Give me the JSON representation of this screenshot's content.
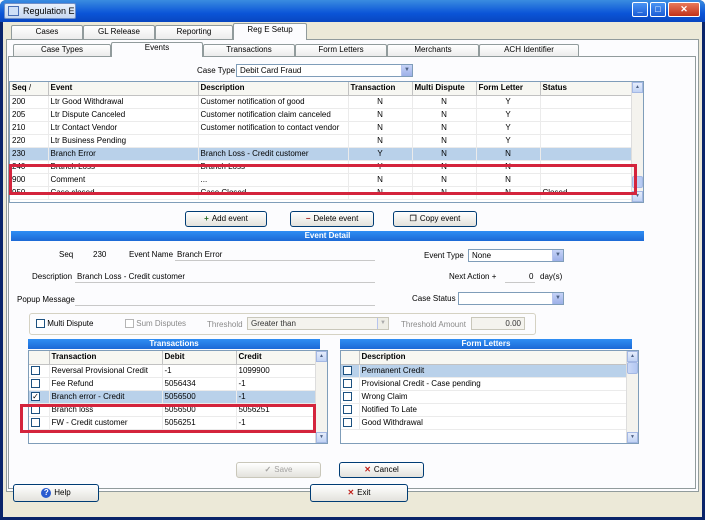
{
  "titlebar": {
    "app_tab": "Regulation E",
    "minimize": "_",
    "maximize": "□",
    "close": "✕"
  },
  "main_tabs": [
    "Cases",
    "GL Release",
    "Reporting",
    "Reg E Setup"
  ],
  "sub_tabs": [
    "Case Types",
    "Events",
    "Transactions",
    "Form Letters",
    "Merchants",
    "ACH Identifier"
  ],
  "case_type": {
    "label": "Case Type",
    "value": "Debit Card Fraud"
  },
  "events_grid": {
    "columns": [
      "Seq",
      "Event",
      "Description",
      "Transaction",
      "Multi Dispute",
      "Form Letter",
      "Status"
    ],
    "sort_indicator": "/",
    "rows": [
      {
        "seq": "200",
        "event": "Ltr Good Withdrawal",
        "description": "Customer notification of good",
        "transaction": "N",
        "multi": "N",
        "form": "Y",
        "status": ""
      },
      {
        "seq": "205",
        "event": "Ltr Dispute Canceled",
        "description": "Customer notification claim canceled",
        "transaction": "N",
        "multi": "N",
        "form": "Y",
        "status": ""
      },
      {
        "seq": "210",
        "event": "Ltr Contact Vendor",
        "description": "Customer notification to contact vendor",
        "transaction": "N",
        "multi": "N",
        "form": "Y",
        "status": ""
      },
      {
        "seq": "220",
        "event": "Ltr Business Pending",
        "description": "",
        "transaction": "N",
        "multi": "N",
        "form": "Y",
        "status": ""
      },
      {
        "seq": "230",
        "event": "Branch Error",
        "description": "Branch Loss - Credit customer",
        "transaction": "Y",
        "multi": "N",
        "form": "N",
        "status": ""
      },
      {
        "seq": "240",
        "event": "Branch Loss",
        "description": "Branch Loss",
        "transaction": "Y",
        "multi": "N",
        "form": "N",
        "status": ""
      },
      {
        "seq": "900",
        "event": "Comment",
        "description": "...",
        "transaction": "N",
        "multi": "N",
        "form": "N",
        "status": ""
      },
      {
        "seq": "950",
        "event": "Case closed",
        "description": "Case Closed",
        "transaction": "N",
        "multi": "N",
        "form": "N",
        "status": "Closed"
      }
    ]
  },
  "event_buttons": {
    "add": "Add event",
    "delete": "Delete event",
    "copy": "Copy event"
  },
  "event_detail": {
    "header": "Event Detail",
    "seq_label": "Seq",
    "seq_value": "230",
    "event_name_label": "Event Name",
    "event_name_value": "Branch Error",
    "description_label": "Description",
    "description_value": "Branch Loss - Credit customer",
    "popup_label": "Popup Message",
    "event_type_label": "Event Type",
    "event_type_value": "None",
    "next_action_label": "Next Action +",
    "next_action_value": "0",
    "next_action_unit": "day(s)",
    "case_status_label": "Case Status",
    "case_status_value": "",
    "multi_dispute_label": "Multi Dispute",
    "sum_disputes_label": "Sum Disputes",
    "threshold_label": "Threshold",
    "threshold_value": "Greater than",
    "threshold_amount_label": "Threshold Amount",
    "threshold_amount_value": "0.00"
  },
  "transactions": {
    "header": "Transactions",
    "columns": [
      "Transaction",
      "Debit",
      "Credit"
    ],
    "rows": [
      {
        "checked": false,
        "name": "Reversal Provisional Credit",
        "debit": "-1",
        "credit": "1099900"
      },
      {
        "checked": false,
        "name": "Fee Refund",
        "debit": "5056434",
        "credit": "-1"
      },
      {
        "checked": true,
        "name": "Branch error - Credit",
        "debit": "5056500",
        "credit": "-1"
      },
      {
        "checked": false,
        "name": "Branch loss",
        "debit": "5056500",
        "credit": "5056251"
      },
      {
        "checked": false,
        "name": "FW - Credit customer",
        "debit": "5056251",
        "credit": "-1"
      }
    ]
  },
  "form_letters": {
    "header": "Form Letters",
    "columns": [
      "Description"
    ],
    "rows": [
      "Permanent Credit",
      "Provisional Credit - Case pending",
      "Wrong Claim",
      "Notified To Late",
      "Good Withdrawal"
    ]
  },
  "action_buttons": {
    "save": "Save",
    "cancel": "Cancel"
  },
  "footer_buttons": {
    "help": "Help",
    "exit": "Exit"
  },
  "colors": {
    "highlight_box": "#d4243c",
    "section_header": "#1c69d5",
    "selection": "#b9d1ea"
  }
}
